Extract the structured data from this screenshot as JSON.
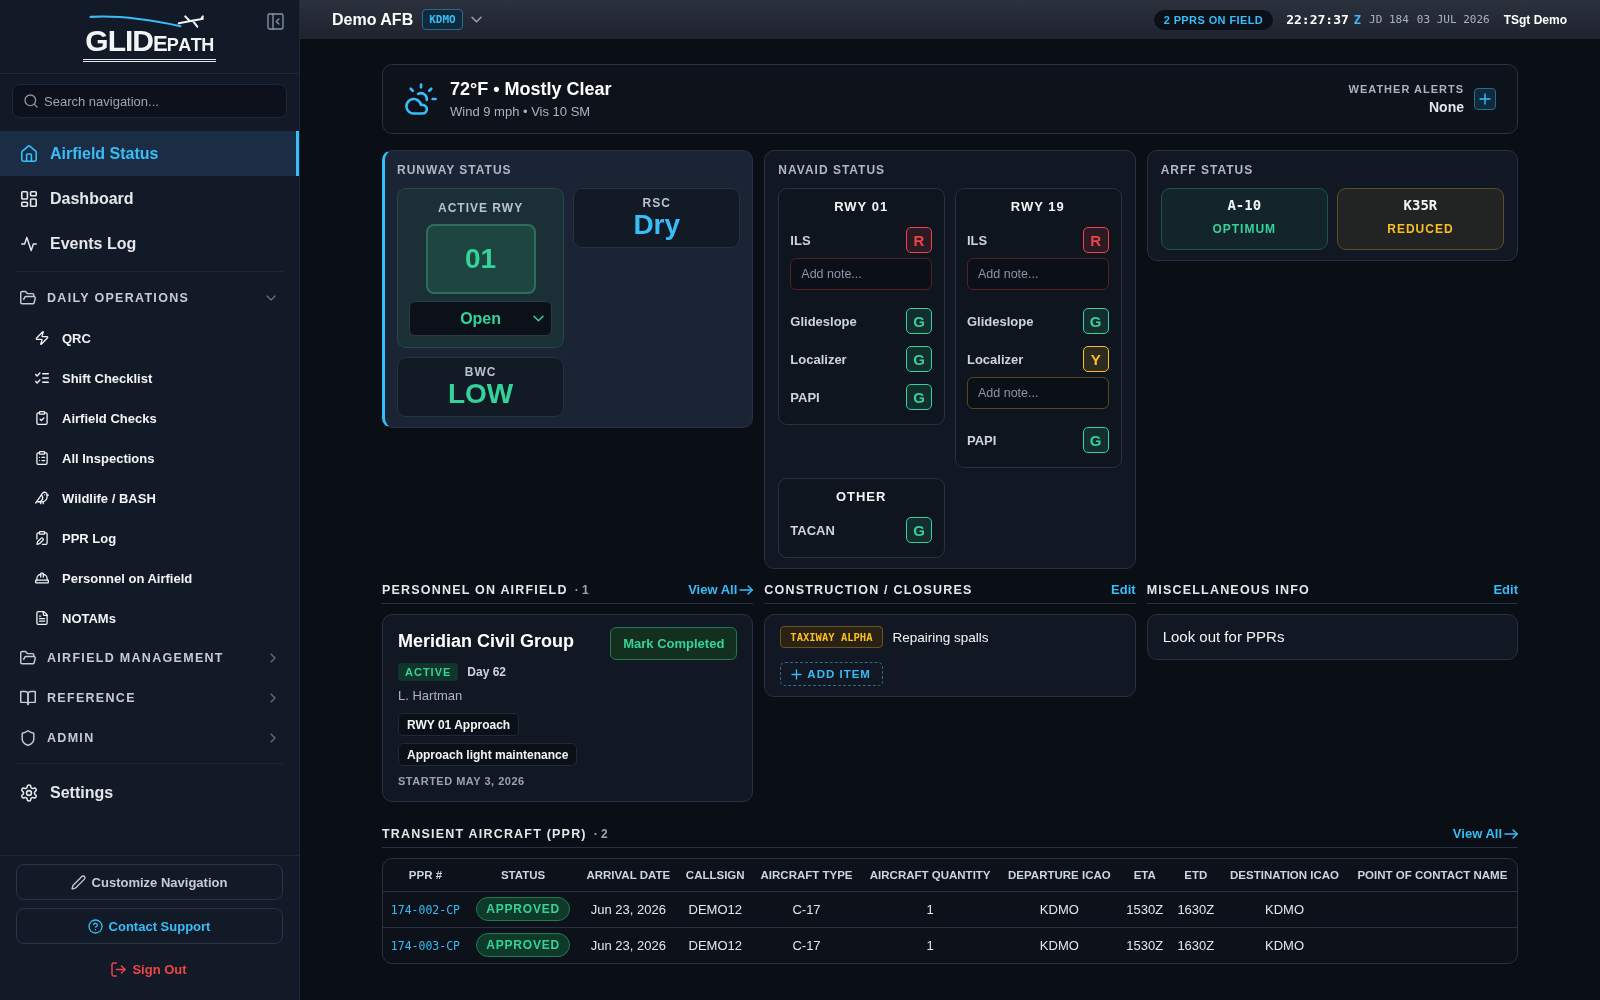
{
  "sidebar": {
    "logo": "GLIDEPATH",
    "search": {
      "placeholder": "Search navigation..."
    },
    "links": [
      {
        "label": "Airfield Status",
        "selected": true
      },
      {
        "label": "Dashboard",
        "selected": false
      },
      {
        "label": "Events Log",
        "selected": false
      }
    ],
    "groups": [
      {
        "label": "DAILY OPERATIONS",
        "expanded": true,
        "children": [
          {
            "label": "QRC",
            "selected": false
          },
          {
            "label": "Shift Checklist",
            "selected": false
          },
          {
            "label": "Airfield Checks",
            "selected": false
          },
          {
            "label": "All Inspections",
            "selected": false
          },
          {
            "label": "Wildlife / BASH",
            "selected": false
          },
          {
            "label": "PPR Log",
            "selected": false
          },
          {
            "label": "Personnel on Airfield",
            "selected": false
          },
          {
            "label": "NOTAMs",
            "selected": false
          }
        ]
      },
      {
        "label": "AIRFIELD MANAGEMENT",
        "expanded": false
      },
      {
        "label": "REFERENCE",
        "expanded": false
      },
      {
        "label": "ADMIN",
        "expanded": false
      }
    ],
    "settings": {
      "label": "Settings",
      "selected": false
    },
    "footer": [
      {
        "kind": "outline",
        "label": "Customize Navigation"
      },
      {
        "kind": "support",
        "label": "Contact Support"
      },
      {
        "kind": "danger",
        "label": "Sign Out"
      }
    ]
  },
  "top_bar": {
    "base_name": "Demo AFB",
    "icao": "KDMO",
    "ppr_badge": "2 PPRS ON FIELD",
    "clock": {
      "time": "22:27:37",
      "zone": "Z",
      "julian_date": "JD 184",
      "date": "03 JUL 2026"
    },
    "user": "TSgt Demo"
  },
  "weather": {
    "headline": "72°F • Mostly Clear",
    "details": "Wind 9 mph • Vis 10 SM",
    "alerts_label": "WEATHER ALERTS",
    "alerts_value": "None"
  },
  "runway_status": {
    "title": "RUNWAY STATUS",
    "active_runway": {
      "label": "ACTIVE RWY",
      "runway": "01",
      "status": "Open"
    },
    "rsc": {
      "label": "RSC",
      "value": "Dry"
    },
    "bwc": {
      "label": "BWC",
      "value": "LOW"
    }
  },
  "navaid_status": {
    "title": "NAVAID STATUS",
    "groups": [
      {
        "title": "RWY 01",
        "navaids": [
          {
            "name": "ILS",
            "status": "R",
            "color": "#ef4444",
            "note": {
              "placeholder": "Add note..."
            }
          },
          {
            "name": "Glideslope",
            "status": "G",
            "color": "#34d399"
          },
          {
            "name": "Localizer",
            "status": "G",
            "color": "#34d399"
          },
          {
            "name": "PAPI",
            "status": "G",
            "color": "#34d399"
          }
        ]
      },
      {
        "title": "RWY 19",
        "navaids": [
          {
            "name": "ILS",
            "status": "R",
            "color": "#ef4444",
            "note": {
              "placeholder": "Add note..."
            }
          },
          {
            "name": "Glideslope",
            "status": "G",
            "color": "#34d399"
          },
          {
            "name": "Localizer",
            "status": "Y",
            "color": "#fbbf24",
            "note": {
              "placeholder": "Add note..."
            }
          },
          {
            "name": "PAPI",
            "status": "G",
            "color": "#34d399"
          }
        ]
      },
      {
        "title": "OTHER",
        "navaids": [
          {
            "name": "TACAN",
            "status": "G",
            "color": "#34d399"
          }
        ]
      }
    ]
  },
  "arff_status": {
    "title": "ARFF STATUS",
    "aircraft": [
      {
        "name": "A-10",
        "status": "OPTIMUM",
        "color": "#34d399"
      },
      {
        "name": "K35R",
        "status": "REDUCED",
        "color": "#fbbf24"
      }
    ]
  },
  "personnel": {
    "title": "PERSONNEL ON AIRFIELD",
    "count": "· 1",
    "view_all": "View All",
    "entries": [
      {
        "company": "Meridian Civil Group",
        "action": "Mark Completed",
        "status": "ACTIVE",
        "day": "Day 62",
        "contact": "L. Hartman",
        "tags": [
          "RWY 01 Approach",
          "Approach light maintenance"
        ],
        "started": "STARTED MAY 3, 2026"
      }
    ]
  },
  "construction": {
    "title": "CONSTRUCTION / CLOSURES",
    "edit": "Edit",
    "items": [
      {
        "tag": "TAXIWAY ALPHA",
        "description": "Repairing spalls"
      }
    ],
    "add_button": "ADD ITEM"
  },
  "misc_info": {
    "title": "MISCELLANEOUS INFO",
    "edit": "Edit",
    "text": "Look out for PPRs"
  },
  "transient_aircraft": {
    "title": "TRANSIENT AIRCRAFT (PPR)",
    "count": "· 2",
    "view_all": "View All",
    "table": {
      "columns": [
        "PPR #",
        "STATUS",
        "ARRIVAL DATE",
        "CALLSIGN",
        "AIRCRAFT TYPE",
        "AIRCRAFT QUANTITY",
        "DEPARTURE ICAO",
        "ETA",
        "ETD",
        "DESTINATION ICAO",
        "POINT OF CONTACT NAME"
      ],
      "rows": [
        {
          "cells": [
            "174-002-CP",
            "APPROVED",
            "Jun 23, 2026",
            "DEMO12",
            "C-17",
            "1",
            "KDMO",
            "1530Z",
            "1630Z",
            "KDMO"
          ]
        },
        {
          "cells": [
            "174-003-CP",
            "APPROVED",
            "Jun 23, 2026",
            "DEMO12",
            "C-17",
            "1",
            "KDMO",
            "1530Z",
            "1630Z",
            "KDMO"
          ]
        }
      ]
    }
  }
}
